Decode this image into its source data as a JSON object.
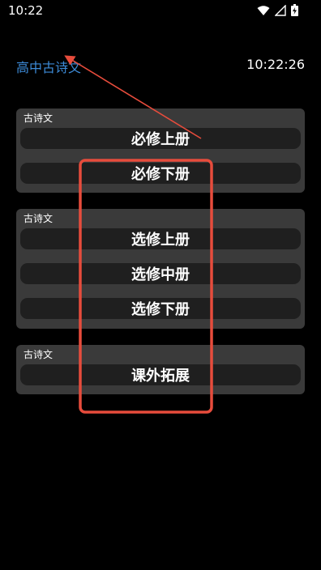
{
  "status_bar": {
    "time": "10:22",
    "icons": [
      "wifi-icon",
      "signal-icon",
      "battery-icon"
    ]
  },
  "header": {
    "title": "高中古诗文",
    "clock": "10:22:26"
  },
  "groups": [
    {
      "label": "古诗文",
      "buttons": [
        "必修上册",
        "必修下册"
      ]
    },
    {
      "label": "古诗文",
      "buttons": [
        "选修上册",
        "选修中册",
        "选修下册"
      ]
    },
    {
      "label": "古诗文",
      "buttons": [
        "课外拓展"
      ]
    }
  ],
  "colors": {
    "title_blue": "#3d8bd8",
    "annotation_red": "#e74c3c"
  }
}
